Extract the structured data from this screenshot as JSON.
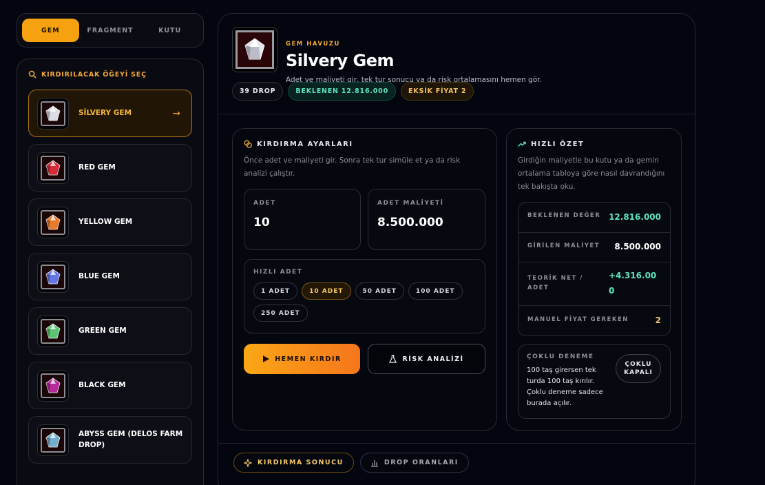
{
  "tabs": [
    {
      "label": "GEM",
      "active": true
    },
    {
      "label": "FRAGMENT",
      "active": false
    },
    {
      "label": "KUTU",
      "active": false
    }
  ],
  "sidebar": {
    "heading": "KIRDIRILACAK ÖĞEYİ SEÇ",
    "items": [
      {
        "name": "SİLVERY GEM",
        "color": "#e8e8f0",
        "active": true
      },
      {
        "name": "RED GEM",
        "color": "#e0303a"
      },
      {
        "name": "YELLOW GEM",
        "color": "#f5822a"
      },
      {
        "name": "BLUE GEM",
        "color": "#6a7ef0"
      },
      {
        "name": "GREEN GEM",
        "color": "#5fd07a"
      },
      {
        "name": "BLACK GEM",
        "color": "#c02aa0"
      },
      {
        "name": "ABYSS GEM (DELOS FARM DROP)",
        "color": "#7ab8d8"
      }
    ]
  },
  "hero": {
    "kicker": "GEM HAVUZU",
    "title": "Silvery Gem",
    "subtitle": "Adet ve maliyeti gir, tek tur sonucu ya da risk ortalamasını hemen gör."
  },
  "chips": {
    "drop": "39 DROP",
    "expected": "BEKLENEN 12.816.000",
    "missing": "EKSİK FİYAT 2"
  },
  "settings": {
    "title": "KIRDIRMA AYARLARI",
    "desc": "Önce adet ve maliyeti gir. Sonra tek tur simüle et ya da risk analizi çalıştır.",
    "qty_label": "ADET",
    "qty_value": "10",
    "cost_label": "ADET MALİYETİ",
    "cost_value": "8.500.000",
    "quick_label": "HIZLI ADET",
    "quick": [
      "1 ADET",
      "10 ADET",
      "50 ADET",
      "100 ADET",
      "250 ADET"
    ],
    "quick_active": 1,
    "run_label": "HEMEN KIRDIR",
    "risk_label": "RİSK ANALİZİ"
  },
  "summary": {
    "title": "HIZLI ÖZET",
    "desc": "Girdiğin maliyetle bu kutu ya da gemin ortalama tabloya göre nasıl davrandığını tek bakışta oku.",
    "expected_label": "BEKLENEN DEĞER",
    "expected_value": "12.816.000",
    "cost_label": "GİRİLEN MALİYET",
    "cost_value": "8.500.000",
    "net_label": "TEORİK NET / ADET",
    "net_value": "+4.316.000",
    "manual_label": "MANUEL FİYAT GEREKEN",
    "manual_value": "2",
    "multi_label": "ÇOKLU DENEME",
    "multi_text": "100 taş girersen tek turda 100 taş kırılır. Çoklu deneme sadece burada açılır.",
    "multi_toggle": "ÇOKLU KAPALI"
  },
  "bottom_tabs": {
    "result": "KIRDIRMA SONUCU",
    "drops": "DROP ORANLARI"
  }
}
